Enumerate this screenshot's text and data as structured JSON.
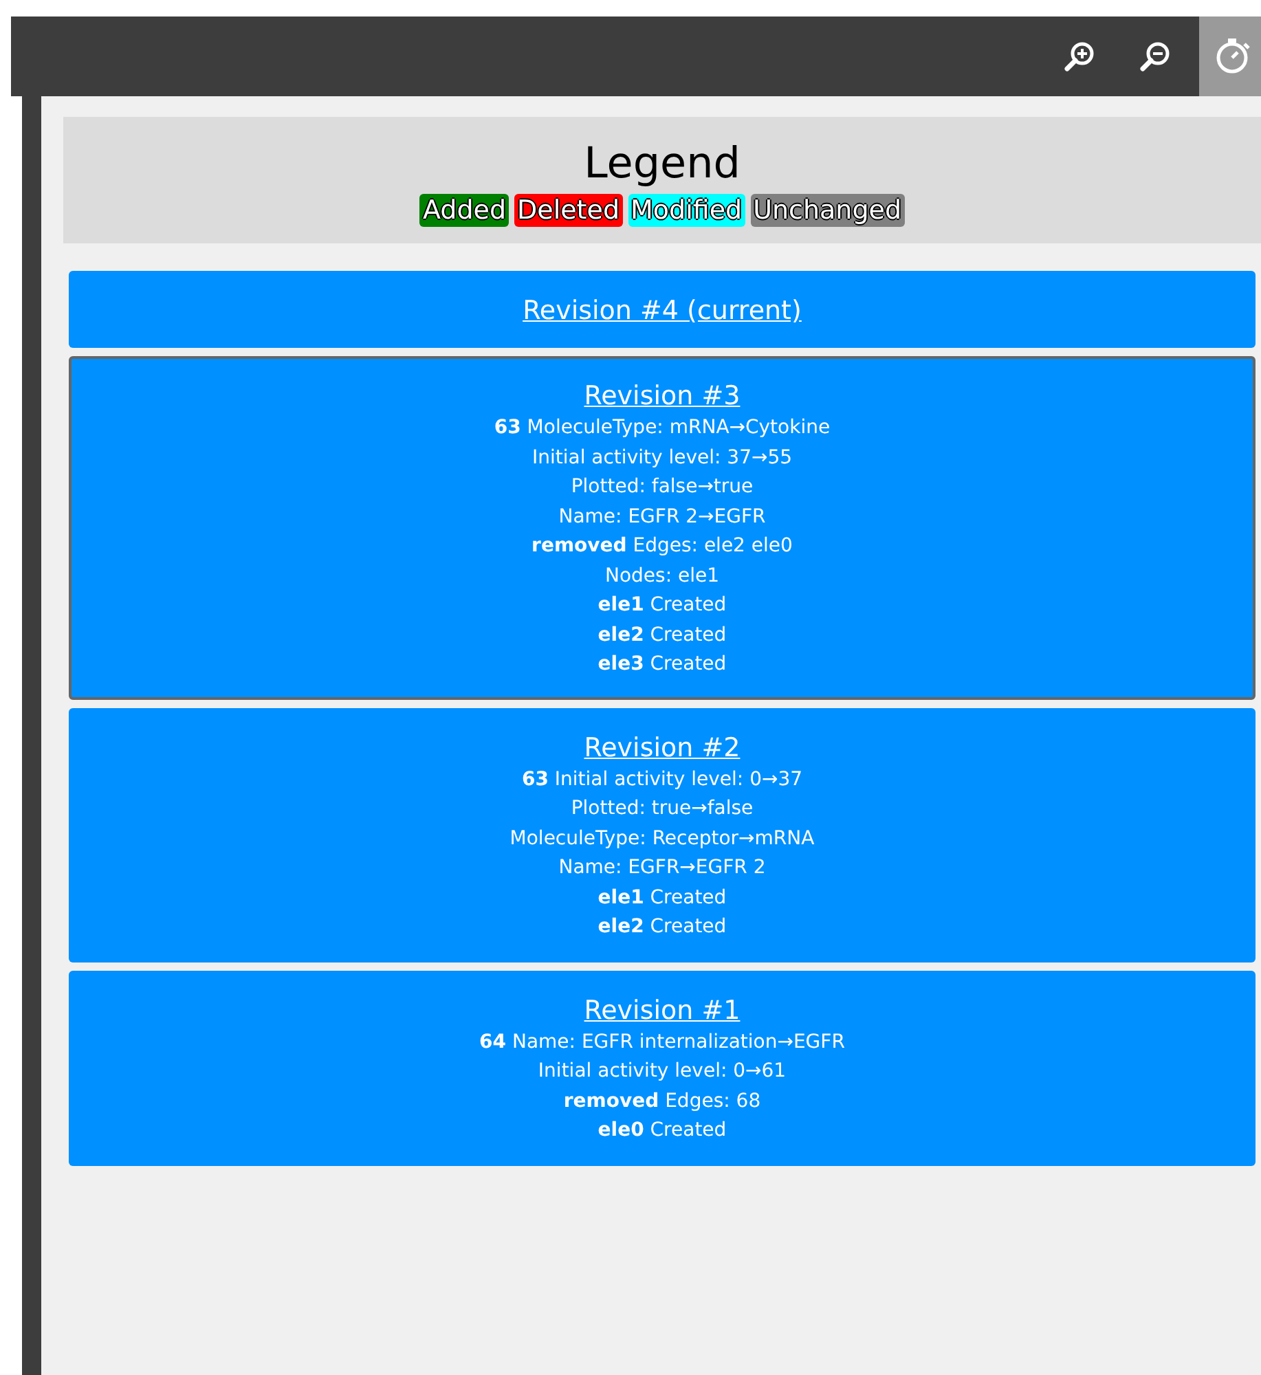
{
  "toolbar": {
    "buttons": [
      {
        "kind": "zoom-in",
        "selected": false
      },
      {
        "kind": "zoom-out",
        "selected": false
      },
      {
        "kind": "history",
        "selected": true
      }
    ]
  },
  "legend": {
    "title": "Legend",
    "items": [
      {
        "label": "Added",
        "color": "#008000"
      },
      {
        "label": "Deleted",
        "color": "#ff0000"
      },
      {
        "label": "Modified",
        "color": "#00ffff"
      },
      {
        "label": "Unchanged",
        "color": "#808080"
      }
    ]
  },
  "revisions": [
    {
      "title": "Revision #4 (current)",
      "selected": false
    },
    {
      "title": "Revision #3",
      "selected": true,
      "lines": [
        "**63** MoleculeType: mRNA→Cytokine",
        "Initial activity level: 37→55",
        "Plotted: false→true",
        "Name: EGFR 2→EGFR",
        "**removed** Edges: ele2 ele0",
        "Nodes: ele1",
        "**ele1** Created",
        "**ele2** Created",
        "**ele3** Created"
      ]
    },
    {
      "title": "Revision #2",
      "selected": false,
      "lines": [
        "**63** Initial activity level: 0→37",
        "Plotted: true→false",
        "MoleculeType: Receptor→mRNA",
        "Name: EGFR→EGFR 2",
        "**ele1** Created",
        "**ele2** Created"
      ]
    },
    {
      "title": "Revision #1",
      "selected": false,
      "lines": [
        "**64** Name: EGFR internalization→EGFR",
        "Initial activity level: 0→61",
        "**removed** Edges: 68",
        "**ele0** Created"
      ]
    }
  ]
}
